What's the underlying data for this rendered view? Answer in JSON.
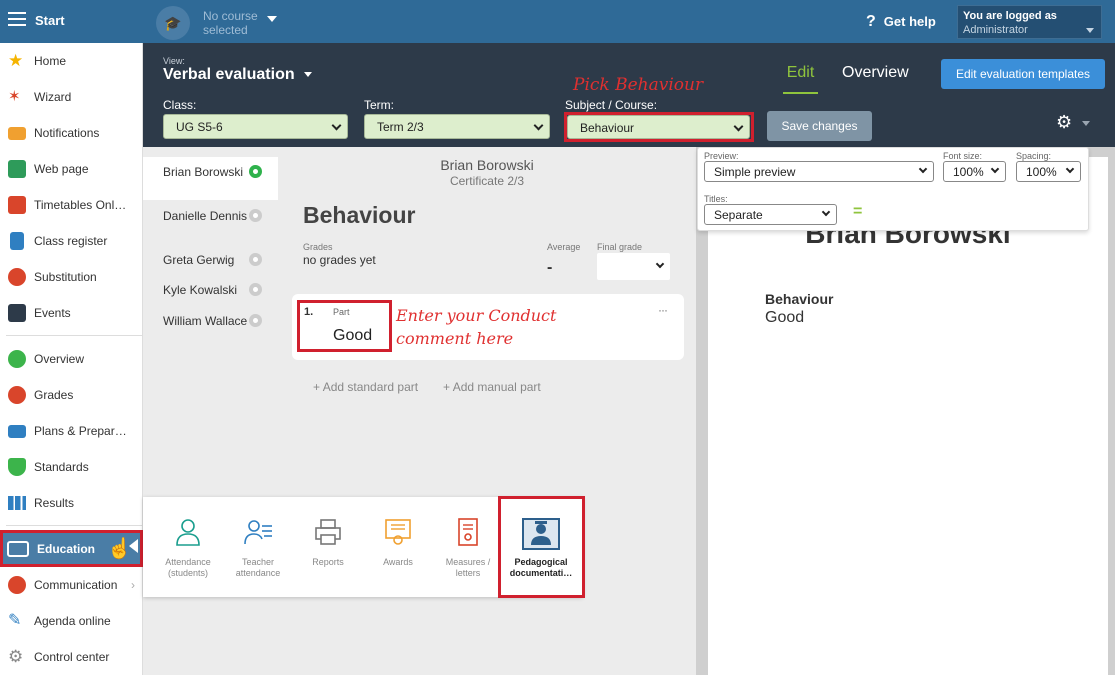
{
  "topbar": {
    "start_label": "Start",
    "course_line1": "No course",
    "course_line2": "selected",
    "help_label": "Get help",
    "logged_label": "You are logged as",
    "logged_user": "Administrator"
  },
  "sidebar": {
    "items": [
      {
        "label": "Home",
        "icon": "star-icon",
        "color": "#f5b400"
      },
      {
        "label": "Wizard",
        "icon": "wand-icon",
        "color": "#d9452b"
      },
      {
        "label": "Notifications",
        "icon": "envelope-icon",
        "color": "#f0a030"
      },
      {
        "label": "Web page",
        "icon": "house-icon",
        "color": "#2e9b5a"
      },
      {
        "label": "Timetables Onl…",
        "icon": "timetable-icon",
        "color": "#d9452b"
      },
      {
        "label": "Class register",
        "icon": "register-icon",
        "color": "#2f7fc1"
      },
      {
        "label": "Substitution",
        "icon": "person-icon",
        "color": "#d9452b"
      },
      {
        "label": "Events",
        "icon": "calendar-icon",
        "color": "#2d3a49"
      },
      {
        "label": "Overview",
        "icon": "check-circle-icon",
        "color": "#3cb44b"
      },
      {
        "label": "Grades",
        "icon": "grades-icon",
        "color": "#d9452b"
      },
      {
        "label": "Plans & Prepar…",
        "icon": "briefcase-icon",
        "color": "#2f7fc1"
      },
      {
        "label": "Standards",
        "icon": "shield-check-icon",
        "color": "#3cb44b"
      },
      {
        "label": "Results",
        "icon": "bar-chart-icon",
        "color": "#2f7fc1"
      },
      {
        "label": "Education",
        "icon": "book-icon",
        "color": "#ffffff"
      },
      {
        "label": "Communication",
        "icon": "chat-icon",
        "color": "#d9452b"
      },
      {
        "label": "Agenda online",
        "icon": "pen-icon",
        "color": "#2f7fc1"
      },
      {
        "label": "Control center",
        "icon": "gear-icon",
        "color": "#888888"
      }
    ]
  },
  "header": {
    "view_label": "View:",
    "view_value": "Verbal evaluation",
    "class_label": "Class:",
    "class_value": "UG S5-6",
    "term_label": "Term:",
    "term_value": "Term 2/3",
    "subject_label": "Subject / Course:",
    "subject_value": "Behaviour",
    "save_label": "Save changes",
    "tab_edit": "Edit",
    "tab_overview": "Overview",
    "edit_templates_label": "Edit evaluation templates",
    "annotation_pick": "Pick Behaviour"
  },
  "students": [
    {
      "name": "Brian Borowski",
      "active": true
    },
    {
      "name": "Danielle Dennis",
      "active": false
    },
    {
      "name": "Greta Gerwig",
      "active": false
    },
    {
      "name": "Kyle Kowalski",
      "active": false
    },
    {
      "name": "William Wallace",
      "active": false
    }
  ],
  "main": {
    "student_name": "Brian Borowski",
    "certificate": "Certificate 2/3",
    "subject_title": "Behaviour",
    "grades_label": "Grades",
    "grades_value": "no grades yet",
    "average_label": "Average",
    "average_value": "-",
    "final_grade_label": "Final grade",
    "part_number": "1.",
    "part_label": "Part",
    "part_value": "Good",
    "more_dots": "···",
    "comment_line1": "Enter your Conduct",
    "comment_line2": "comment here",
    "add_standard": "Add standard part",
    "add_manual": "Add manual part"
  },
  "preview": {
    "preview_label": "Preview:",
    "preview_value": "Simple preview",
    "fontsize_label": "Font size:",
    "fontsize_value": "100%",
    "spacing_label": "Spacing:",
    "spacing_value": "100%",
    "titles_label": "Titles:",
    "titles_value": "Separate",
    "eq_icon": "=",
    "name": "Brian Borowski",
    "subject": "Behaviour",
    "value": "Good"
  },
  "education_panel": {
    "items": [
      {
        "label1": "Attendance",
        "label2": "(students)"
      },
      {
        "label1": "Teacher",
        "label2": "attendance"
      },
      {
        "label1": "Reports",
        "label2": ""
      },
      {
        "label1": "Awards",
        "label2": ""
      },
      {
        "label1": "Measures /",
        "label2": "letters"
      },
      {
        "label1": "Pedagogical",
        "label2": "documentati…"
      }
    ]
  }
}
